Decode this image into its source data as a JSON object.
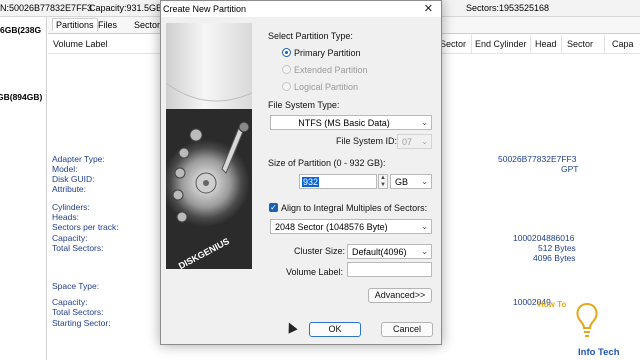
{
  "topbar": {
    "disk_id": "N:50026B77832E7FF3",
    "capacity": "Capacity:931.5GB",
    "sectors": "Sectors:1953525168"
  },
  "left_pane": {
    "disk1": "6GB(238G",
    "disk2": "GB(894GB)"
  },
  "tabs": [
    "Partitions",
    "Files",
    "Sector"
  ],
  "columns": {
    "volume_label": "Volume Label",
    "sector1": "Sector",
    "end_cylinder": "End Cylinder",
    "head": "Head",
    "sector2": "Sector",
    "capacity": "Capa"
  },
  "info": {
    "adapter_type": "Adapter Type:",
    "model": "Model:",
    "disk_guid": "Disk GUID:",
    "attribute": "Attribute:",
    "cylinders": "Cylinders:",
    "heads": "Heads:",
    "sectors_per_track": "Sectors per track:",
    "capacity": "Capacity:",
    "total_sectors": "Total Sectors:",
    "space_type": "Space Type:",
    "capacity2": "Capacity:",
    "total_sectors2": "Total Sectors:",
    "starting_sector": "Starting Sector:"
  },
  "values": {
    "serial": "50026B77832E7FF3",
    "partition_style": "GPT",
    "total_bytes": "1000204886016",
    "sector_size1": "512 Bytes",
    "sector_size2": "4096 Bytes",
    "partial_value": "10002049"
  },
  "dialog": {
    "title": "Create New Partition",
    "close_glyph": "✕",
    "banner_text": "DISKGENIUS",
    "partition_type_label": "Select Partition Type:",
    "partition_types": [
      {
        "label": "Primary Partition",
        "selected": true,
        "enabled": true
      },
      {
        "label": "Extended Partition",
        "selected": false,
        "enabled": false
      },
      {
        "label": "Logical Partition",
        "selected": false,
        "enabled": false
      }
    ],
    "fs_type_label": "File System Type:",
    "fs_type_value": "NTFS (MS Basic Data)",
    "fs_id_label": "File System ID:",
    "fs_id_value": "07",
    "size_label": "Size of Partition (0 - 932 GB):",
    "size_value": "932",
    "size_unit": "GB",
    "align_label": "Align to Integral Multiples of Sectors:",
    "align_checked": true,
    "align_value": "2048 Sector (1048576 Byte)",
    "cluster_label": "Cluster Size:",
    "cluster_value": "Default(4096)",
    "volume_label": "Volume Label:",
    "volume_value": "",
    "advanced_button": "Advanced>>",
    "ok_button": "OK",
    "cancel_button": "Cancel"
  },
  "watermark": {
    "top": "How To",
    "bottom": "Info Tech"
  },
  "icons": {
    "close": "close-icon",
    "dropdown": "chevron-down-icon",
    "spin_up": "spin-up-icon",
    "spin_down": "spin-down-icon",
    "check": "checkmark-icon",
    "hdd": "hard-disk-icon"
  },
  "colors": {
    "accent": "#1a5fb4",
    "info_text": "#1f3f8c",
    "selection": "#0a64d8"
  }
}
